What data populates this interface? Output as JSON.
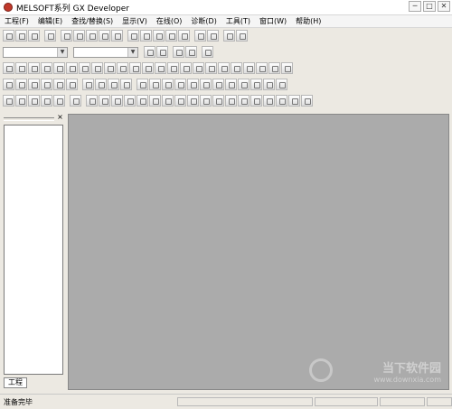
{
  "window": {
    "title": "MELSOFT系列 GX Developer",
    "controls": {
      "minimize": "─",
      "maximize": "□",
      "close": "✕"
    }
  },
  "menu": [
    "工程(F)",
    "编辑(E)",
    "查找/替换(S)",
    "显示(V)",
    "在线(O)",
    "诊断(D)",
    "工具(T)",
    "窗口(W)",
    "帮助(H)"
  ],
  "panel": {
    "close": "×",
    "tab_label": "工程"
  },
  "watermark": {
    "name": "当下软件园",
    "url": "www.downxia.com"
  },
  "status": {
    "text": "准备完毕"
  }
}
